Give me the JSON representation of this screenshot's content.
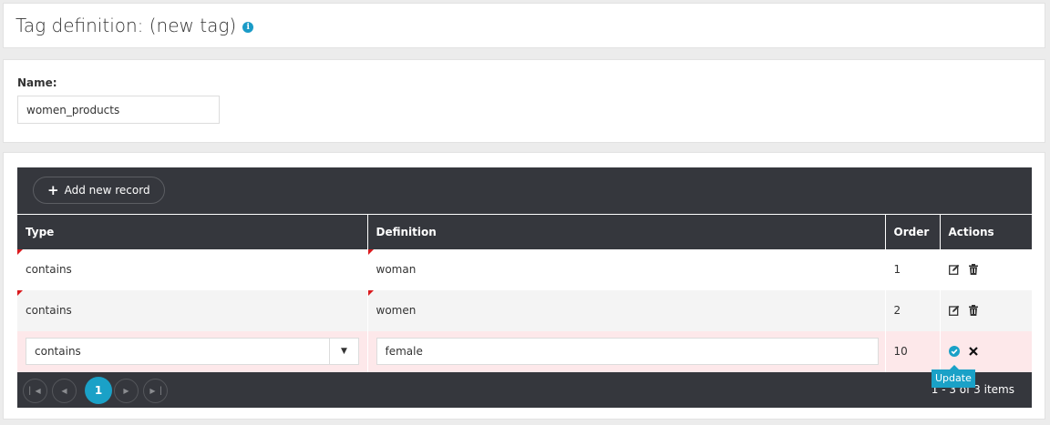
{
  "header": {
    "title": "Tag definition: (new tag)",
    "info_icon": "info-circle-icon"
  },
  "form": {
    "name_label": "Name:",
    "name_value": "women_products"
  },
  "grid": {
    "add_button_label": "Add new record",
    "columns": [
      "Type",
      "Definition",
      "Order",
      "Actions"
    ],
    "rows": [
      {
        "type": "contains",
        "definition": "woman",
        "order": "1"
      },
      {
        "type": "contains",
        "definition": "women",
        "order": "2"
      }
    ],
    "edit_row": {
      "type": "contains",
      "definition": "female",
      "order": "10"
    },
    "tooltip": "Update",
    "pager": {
      "current_page": "1",
      "info": "1 - 3 of 3 items"
    }
  },
  "colors": {
    "accent": "#1aa1c7",
    "grid_dark": "#35373d",
    "edit_row_bg": "#fde8ea",
    "dirty_marker": "#d9191d"
  }
}
